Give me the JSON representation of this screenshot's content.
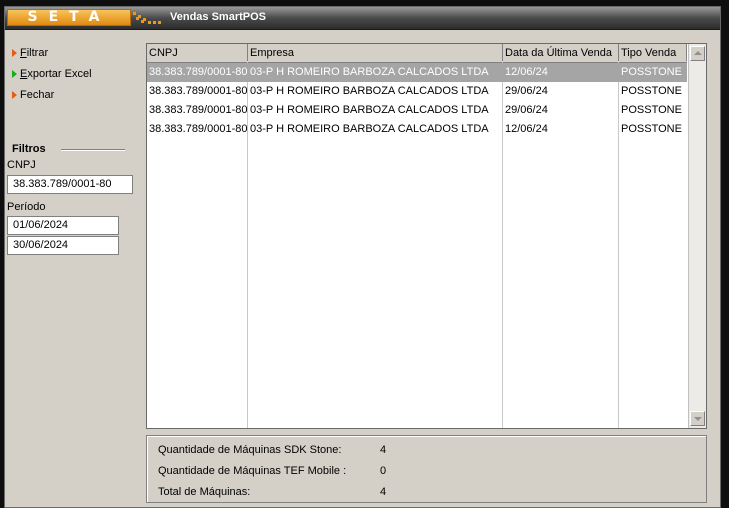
{
  "titlebar": {
    "logo_text": "SETA",
    "title": "Vendas SmartPOS",
    "accent": "#e89a1e"
  },
  "actions": {
    "filtrar": {
      "hot": "F",
      "rest": "iltrar",
      "icon": "orange-triangle",
      "color": "#e85a12"
    },
    "exportar": {
      "hot": "E",
      "rest": "xportar Excel",
      "icon": "green-triangle",
      "color": "#15b015"
    },
    "fechar": {
      "hot": "",
      "rest": "Fechar",
      "icon": "orange-triangle",
      "color": "#e85a12"
    }
  },
  "filtros": {
    "title": "Filtros",
    "cnpj_label": "CNPJ",
    "cnpj_value": "38.383.789/0001-80",
    "periodo_label": "Período",
    "periodo_inicio": "01/06/2024",
    "periodo_fim": "30/06/2024"
  },
  "grid": {
    "columns": [
      "CNPJ",
      "Empresa",
      "Data da Última Venda",
      "Tipo Venda"
    ],
    "rows": [
      [
        "38.383.789/0001-80",
        "03-P H ROMEIRO BARBOZA CALCADOS LTDA",
        "12/06/24",
        "POSSTONE"
      ],
      [
        "38.383.789/0001-80",
        "03-P H ROMEIRO BARBOZA CALCADOS LTDA",
        "29/06/24",
        "POSSTONE"
      ],
      [
        "38.383.789/0001-80",
        "03-P H ROMEIRO BARBOZA CALCADOS LTDA",
        "29/06/24",
        "POSSTONE"
      ],
      [
        "38.383.789/0001-80",
        "03-P H ROMEIRO BARBOZA CALCADOS LTDA",
        "12/06/24",
        "POSSTONE"
      ]
    ],
    "selected_row": 0
  },
  "summary": {
    "sdk_label": "Quantidade de Máquinas SDK Stone:",
    "sdk_value": "4",
    "tef_label": "Quantidade de Máquinas TEF Mobile :",
    "tef_value": "0",
    "total_label": "Total de Máquinas:",
    "total_value": "4"
  }
}
